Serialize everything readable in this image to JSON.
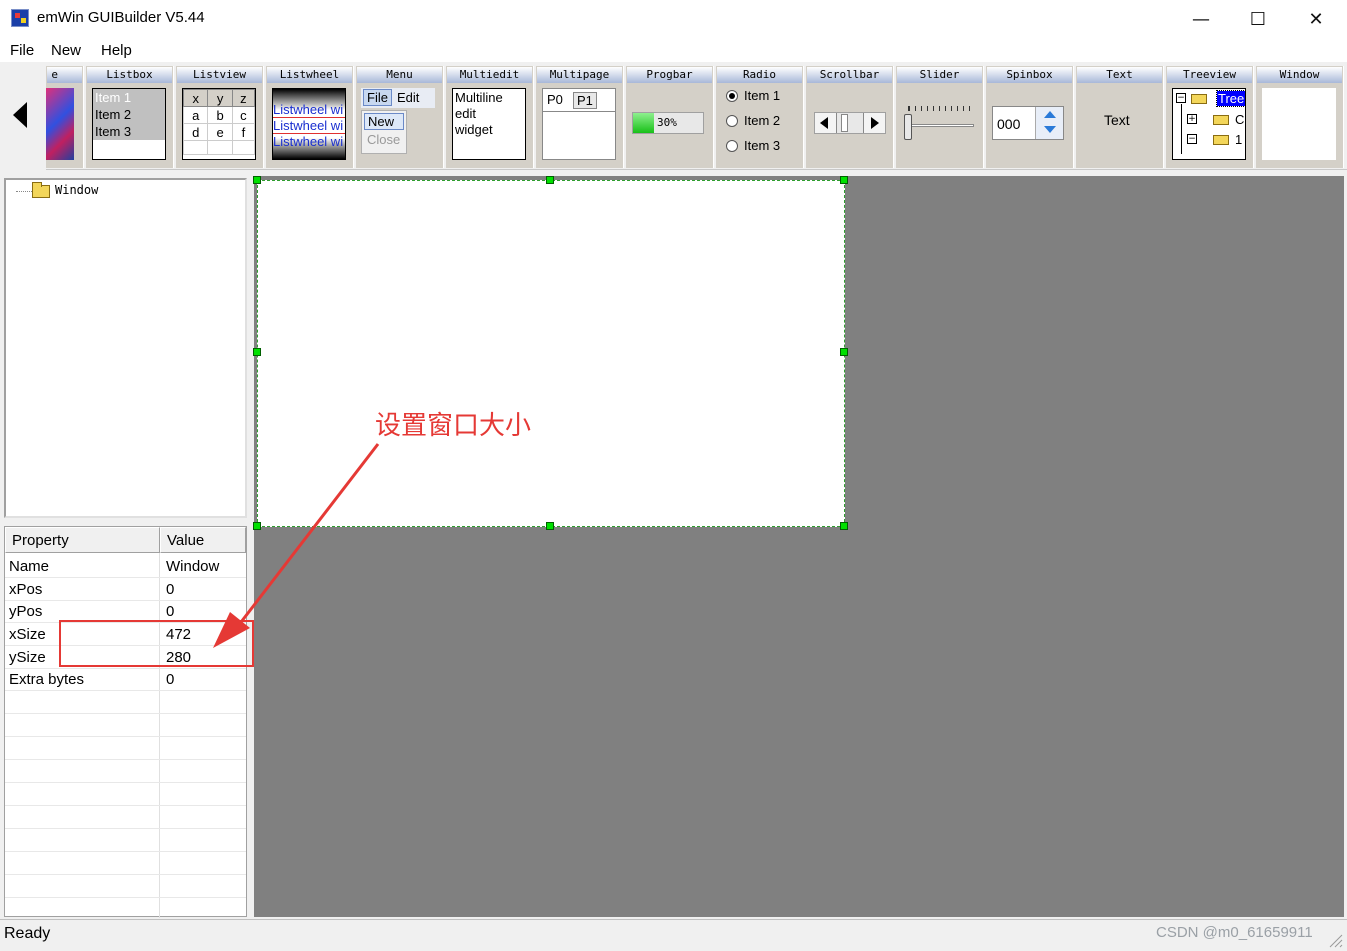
{
  "window": {
    "title": "emWin GUIBuilder V5.44",
    "controls": {
      "minimize": "—",
      "maximize": "☐",
      "close": "✕"
    }
  },
  "menu": [
    "File",
    "New",
    "Help"
  ],
  "toolbar": {
    "first_partial": "e",
    "widgets": [
      {
        "label": "Listbox",
        "items": [
          "Item 1",
          "Item 2",
          "Item 3"
        ]
      },
      {
        "label": "Listview",
        "cells": [
          [
            "x",
            "y",
            "z"
          ],
          [
            "a",
            "b",
            "c"
          ],
          [
            "d",
            "e",
            "f"
          ]
        ]
      },
      {
        "label": "Listwheel",
        "items": [
          "Listwheel wi",
          "Listwheel wi",
          "Listwheel wi"
        ]
      },
      {
        "label": "Menu",
        "items": [
          "File",
          "Edit",
          "New",
          "Close"
        ]
      },
      {
        "label": "Multiedit",
        "text": [
          "Multiline",
          "edit",
          "widget"
        ]
      },
      {
        "label": "Multipage",
        "tabs": [
          "P0",
          "P1"
        ]
      },
      {
        "label": "Progbar",
        "value_text": "30%",
        "progress": 0.3
      },
      {
        "label": "Radio",
        "items": [
          "Item 1",
          "Item 2",
          "Item 3"
        ]
      },
      {
        "label": "Scrollbar"
      },
      {
        "label": "Slider"
      },
      {
        "label": "Spinbox",
        "value": "000"
      },
      {
        "label": "Text",
        "text": "Text"
      },
      {
        "label": "Treeview",
        "root": "Tree",
        "children": [
          "C",
          "1"
        ]
      },
      {
        "label": "Window"
      }
    ]
  },
  "tree": {
    "root": "Window"
  },
  "properties": {
    "headers": [
      "Property",
      "Value"
    ],
    "rows": [
      {
        "name": "Name",
        "value": "Window"
      },
      {
        "name": "xPos",
        "value": "0"
      },
      {
        "name": "yPos",
        "value": "0"
      },
      {
        "name": "xSize",
        "value": "472"
      },
      {
        "name": "ySize",
        "value": "280"
      },
      {
        "name": "Extra bytes",
        "value": "0"
      }
    ]
  },
  "annotation": {
    "text": "设置窗口大小",
    "color": "#e53935"
  },
  "status": {
    "text": "Ready",
    "watermark": "CSDN @m0_61659911"
  },
  "colors": {
    "canvas": "#808080",
    "selection": "#00e000",
    "annotation": "#e53935"
  }
}
